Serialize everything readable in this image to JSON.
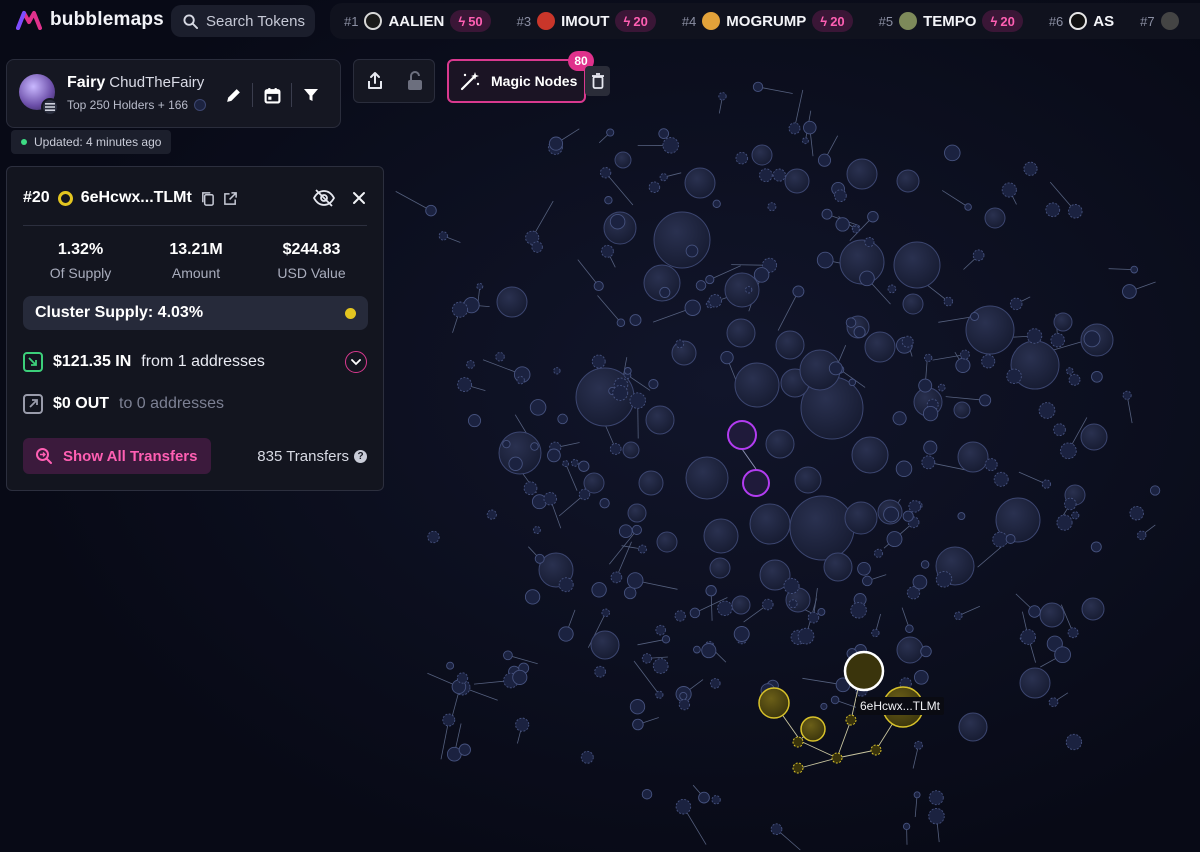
{
  "app": {
    "logo_text": "bubblemaps",
    "search_placeholder": "Search Tokens"
  },
  "trending": [
    {
      "rank": "#1",
      "name": "AALIEN",
      "boost": "50",
      "avatar_color": "#d8d8d8"
    },
    {
      "rank": "#3",
      "name": "IMOUT",
      "boost": "20",
      "avatar_color": "#c9362a"
    },
    {
      "rank": "#4",
      "name": "MOGRUMP",
      "boost": "20",
      "avatar_color": "#e2a23a"
    },
    {
      "rank": "#5",
      "name": "TEMPO",
      "boost": "20",
      "avatar_color": "#7d8a5a"
    },
    {
      "rank": "#6",
      "name": "AS",
      "boost": "",
      "avatar_color": "#e6e6e6"
    },
    {
      "rank": "#7",
      "name": "",
      "boost": "",
      "avatar_color": "#444"
    }
  ],
  "header": {
    "title": "Fairy",
    "handle": "ChudTheFairy",
    "subtitle": "Top 250 Holders + 166",
    "updated": "Updated: 4 minutes ago"
  },
  "magic_nodes": {
    "label": "Magic Nodes",
    "badge": "80"
  },
  "detail": {
    "rank": "#20",
    "address": "6eHcwx...TLMt",
    "stats": [
      {
        "value": "1.32%",
        "label": "Of Supply"
      },
      {
        "value": "13.21M",
        "label": "Amount"
      },
      {
        "value": "$244.83",
        "label": "USD Value"
      }
    ],
    "cluster_supply": "Cluster Supply: 4.03%",
    "in_amount": "$121.35 IN",
    "in_desc": "from 1 addresses",
    "out_amount": "$0 OUT",
    "out_desc": "to 0 addresses",
    "show_transfers": "Show All Transfers",
    "transfers_count": "835 Transfers"
  },
  "node_tooltip": "6eHcwx...TLMt",
  "colors": {
    "accent_pink": "#e0318c",
    "cluster_yellow": "#e3c520",
    "highlight_purple": "#b23cf0",
    "bubble_fill": "#1a2038",
    "bubble_stroke": "#3c4670"
  }
}
